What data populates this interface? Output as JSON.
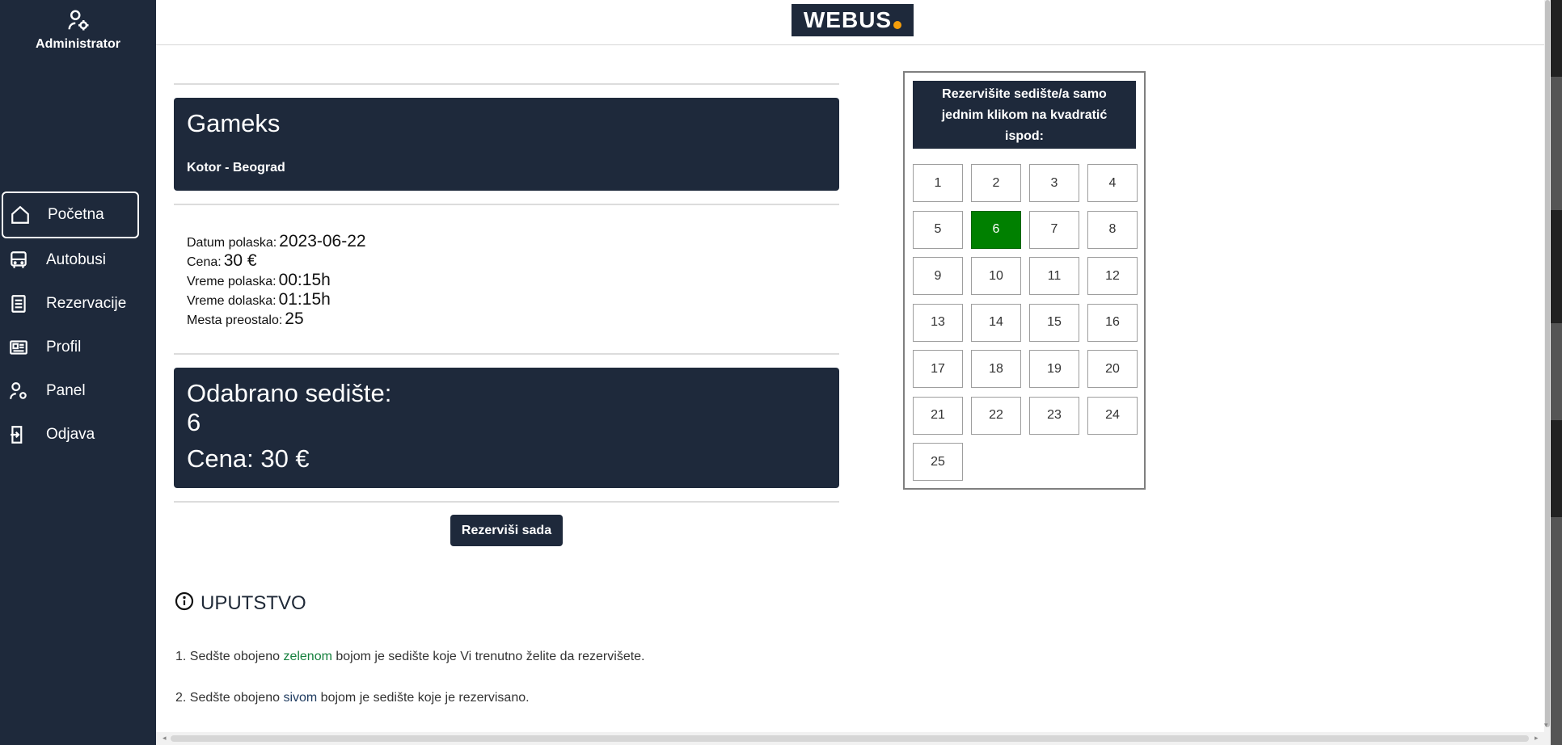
{
  "sidebar": {
    "user": {
      "name": "Administrator",
      "icon": "user-gear-icon"
    },
    "items": [
      {
        "label": "Početna",
        "icon": "home-icon",
        "active": true
      },
      {
        "label": "Autobusi",
        "icon": "bus-icon",
        "active": false
      },
      {
        "label": "Rezervacije",
        "icon": "document-icon",
        "active": false
      },
      {
        "label": "Profil",
        "icon": "id-card-icon",
        "active": false
      },
      {
        "label": "Panel",
        "icon": "user-gear-icon",
        "active": false
      },
      {
        "label": "Odjava",
        "icon": "logout-icon",
        "active": false
      }
    ]
  },
  "header": {
    "logo_text": "WEBUS"
  },
  "trip": {
    "company": "Gameks",
    "route": "Kotor - Beograd",
    "details": [
      {
        "label": "Datum polaska:",
        "value": "2023-06-22"
      },
      {
        "label": "Cena:",
        "value": "30 €"
      },
      {
        "label": "Vreme polaska:",
        "value": "00:15h"
      },
      {
        "label": "Vreme dolaska:",
        "value": "01:15h"
      },
      {
        "label": "Mesta preostalo:",
        "value": "25"
      }
    ]
  },
  "selection": {
    "seat_label": "Odabrano sedište:",
    "seat_value": "6",
    "price_text": "Cena: 30 €"
  },
  "actions": {
    "reserve_label": "Rezerviši sada"
  },
  "instructions": {
    "title": "UPUTSTVO",
    "note1": {
      "prefix": "1. Sedšte obojeno ",
      "highlight": "zelenom",
      "suffix": " bojom je sedište koje Vi trenutno želite da rezervišete."
    },
    "note2": {
      "prefix": "2. Sedšte obojeno ",
      "highlight": "sivom",
      "suffix": " bojom je sedište koje je rezervisano."
    }
  },
  "seat_map": {
    "header": [
      "Rezervišite sedište/a samo",
      "jednim klikom na kvadratić",
      "ispod:"
    ],
    "seats": [
      "1",
      "2",
      "3",
      "4",
      "5",
      "6",
      "7",
      "8",
      "9",
      "10",
      "11",
      "12",
      "13",
      "14",
      "15",
      "16",
      "17",
      "18",
      "19",
      "20",
      "21",
      "22",
      "23",
      "24",
      "25"
    ],
    "selected_seat": "6"
  },
  "colors": {
    "navy": "#1e293b",
    "selected_seat": "#008000",
    "green_text": "#15803d"
  }
}
